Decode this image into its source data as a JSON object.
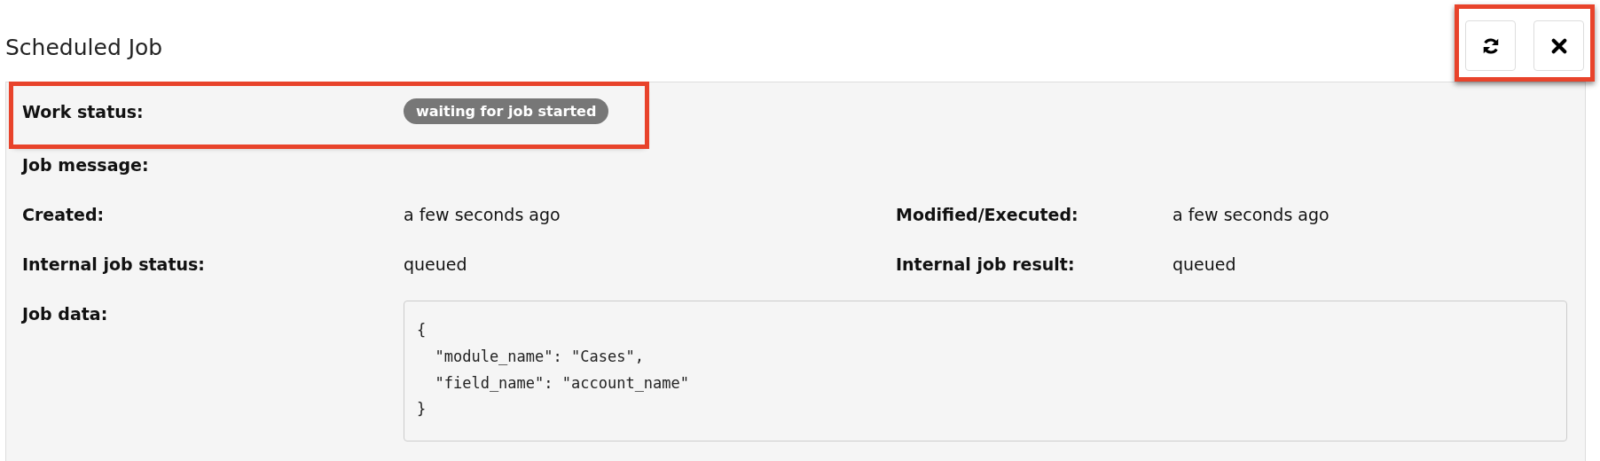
{
  "header": {
    "title": "Scheduled Job",
    "buttons_highlighted": true,
    "buttons": [
      {
        "kind": "refresh"
      },
      {
        "kind": "close"
      }
    ]
  },
  "fields": [
    {
      "label": "Work status:",
      "kind": "badge",
      "value": "waiting for job started",
      "highlighted": true
    },
    {
      "label": "Job message:",
      "kind": "text"
    },
    {
      "label": "Created:",
      "kind": "pair",
      "value": "a few seconds ago",
      "label_2": "Modified/Executed:",
      "value_2": "a few seconds ago"
    },
    {
      "label": "Internal job status:",
      "kind": "pair",
      "value": "queued",
      "label_2": "Internal job result:",
      "value_2": "queued"
    },
    {
      "label": "Job data:",
      "kind": "code",
      "lines": [
        "{",
        "  \"module_name\": \"Cases\",",
        "  \"field_name\": \"account_name\"",
        "}"
      ]
    }
  ]
}
